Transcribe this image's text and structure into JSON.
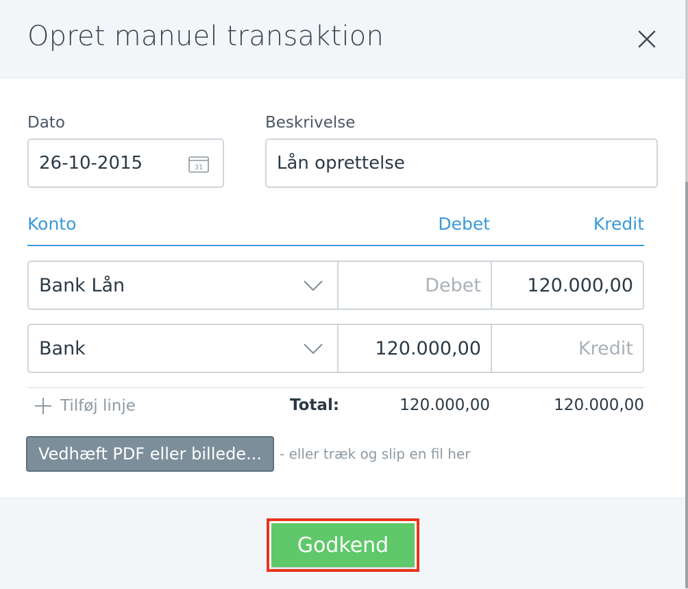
{
  "dialog": {
    "title": "Opret manuel transaktion",
    "close_icon": "close-icon"
  },
  "form": {
    "date": {
      "label": "Dato",
      "value": "26-10-2015",
      "icon": "calendar-icon",
      "icon_text": "31"
    },
    "description": {
      "label": "Beskrivelse",
      "value": "Lån oprettelse"
    }
  },
  "table": {
    "headers": {
      "account": "Konto",
      "debit": "Debet",
      "credit": "Kredit"
    },
    "rows": [
      {
        "account": "Bank Lån",
        "debit": "",
        "debit_placeholder": "Debet",
        "credit": "120.000,00",
        "credit_placeholder": "Kredit"
      },
      {
        "account": "Bank",
        "debit": "120.000,00",
        "debit_placeholder": "Debet",
        "credit": "",
        "credit_placeholder": "Kredit"
      }
    ],
    "add_line_label": "Tilføj linje",
    "total_label": "Total:",
    "total_debit": "120.000,00",
    "total_credit": "120.000,00"
  },
  "attachment": {
    "button_label": "Vedhæft PDF eller billede...",
    "drop_hint": "- eller træk og slip en fil her"
  },
  "footer": {
    "approve_label": "Godkend"
  },
  "colors": {
    "accent_blue": "#3a99d8",
    "approve_green": "#5fc86a",
    "highlight_red": "#e8341c",
    "attach_gray": "#7d8e9b"
  }
}
